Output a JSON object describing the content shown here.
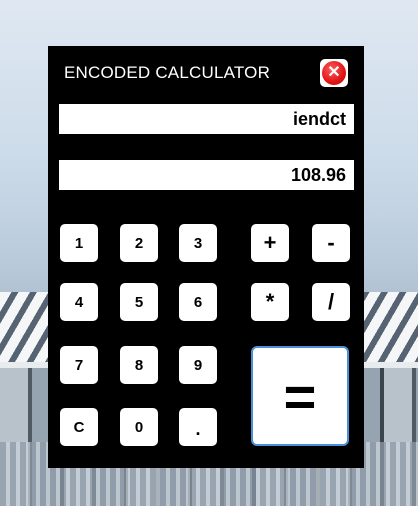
{
  "window": {
    "title": "ENCODED CALCULATOR",
    "close_symbol": "✕",
    "close_icon": "close-icon",
    "accent_color": "#e01515"
  },
  "display": {
    "encoded_text": "iendct",
    "decoded_value": "108.96"
  },
  "keypad": {
    "digits": {
      "one": "1",
      "two": "2",
      "three": "3",
      "four": "4",
      "five": "5",
      "six": "6",
      "seven": "7",
      "eight": "8",
      "nine": "9",
      "zero": "0"
    },
    "clear": "C",
    "decimal": ".",
    "operators": {
      "add": "+",
      "subtract": "-",
      "multiply": "*",
      "divide": "/"
    },
    "equals": "="
  }
}
